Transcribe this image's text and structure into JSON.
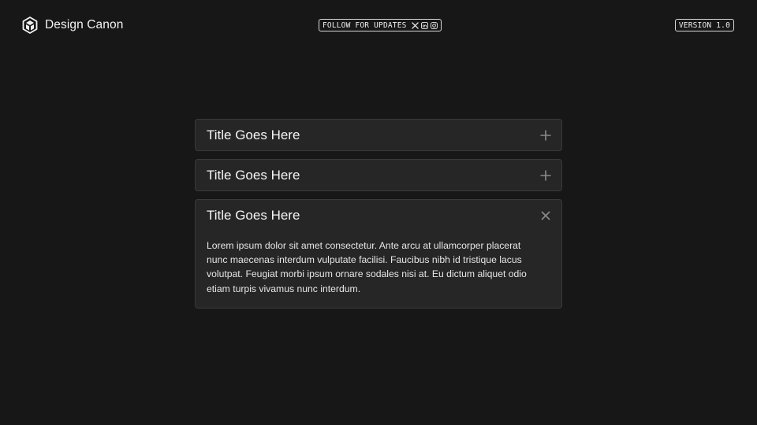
{
  "header": {
    "brand_name": "Design Canon",
    "brand_icon": "cube-logo-icon",
    "follow_label": "FOLLOW FOR UPDATES",
    "social_icons": [
      "x-icon",
      "linkedin-icon",
      "instagram-icon"
    ],
    "version_label": "VERSION 1.0"
  },
  "accordion": {
    "items": [
      {
        "title": "Title Goes Here",
        "expanded": false,
        "toggle_icon": "plus-icon"
      },
      {
        "title": "Title Goes Here",
        "expanded": false,
        "toggle_icon": "plus-icon"
      },
      {
        "title": "Title Goes Here",
        "expanded": true,
        "toggle_icon": "close-icon",
        "body": "Lorem ipsum dolor sit amet consectetur. Ante arcu at ullamcorper placerat nunc maecenas interdum vulputate facilisi. Faucibus nibh id tristique lacus volutpat. Feugiat morbi ipsum ornare sodales nisi at. Eu dictum aliquet odio etiam turpis vivamus nunc interdum."
      }
    ]
  },
  "colors": {
    "background": "#171717",
    "panel": "#262626",
    "panel_border": "#3a3a3a",
    "text": "#f5f5f5",
    "icon": "#8a8a8a"
  }
}
